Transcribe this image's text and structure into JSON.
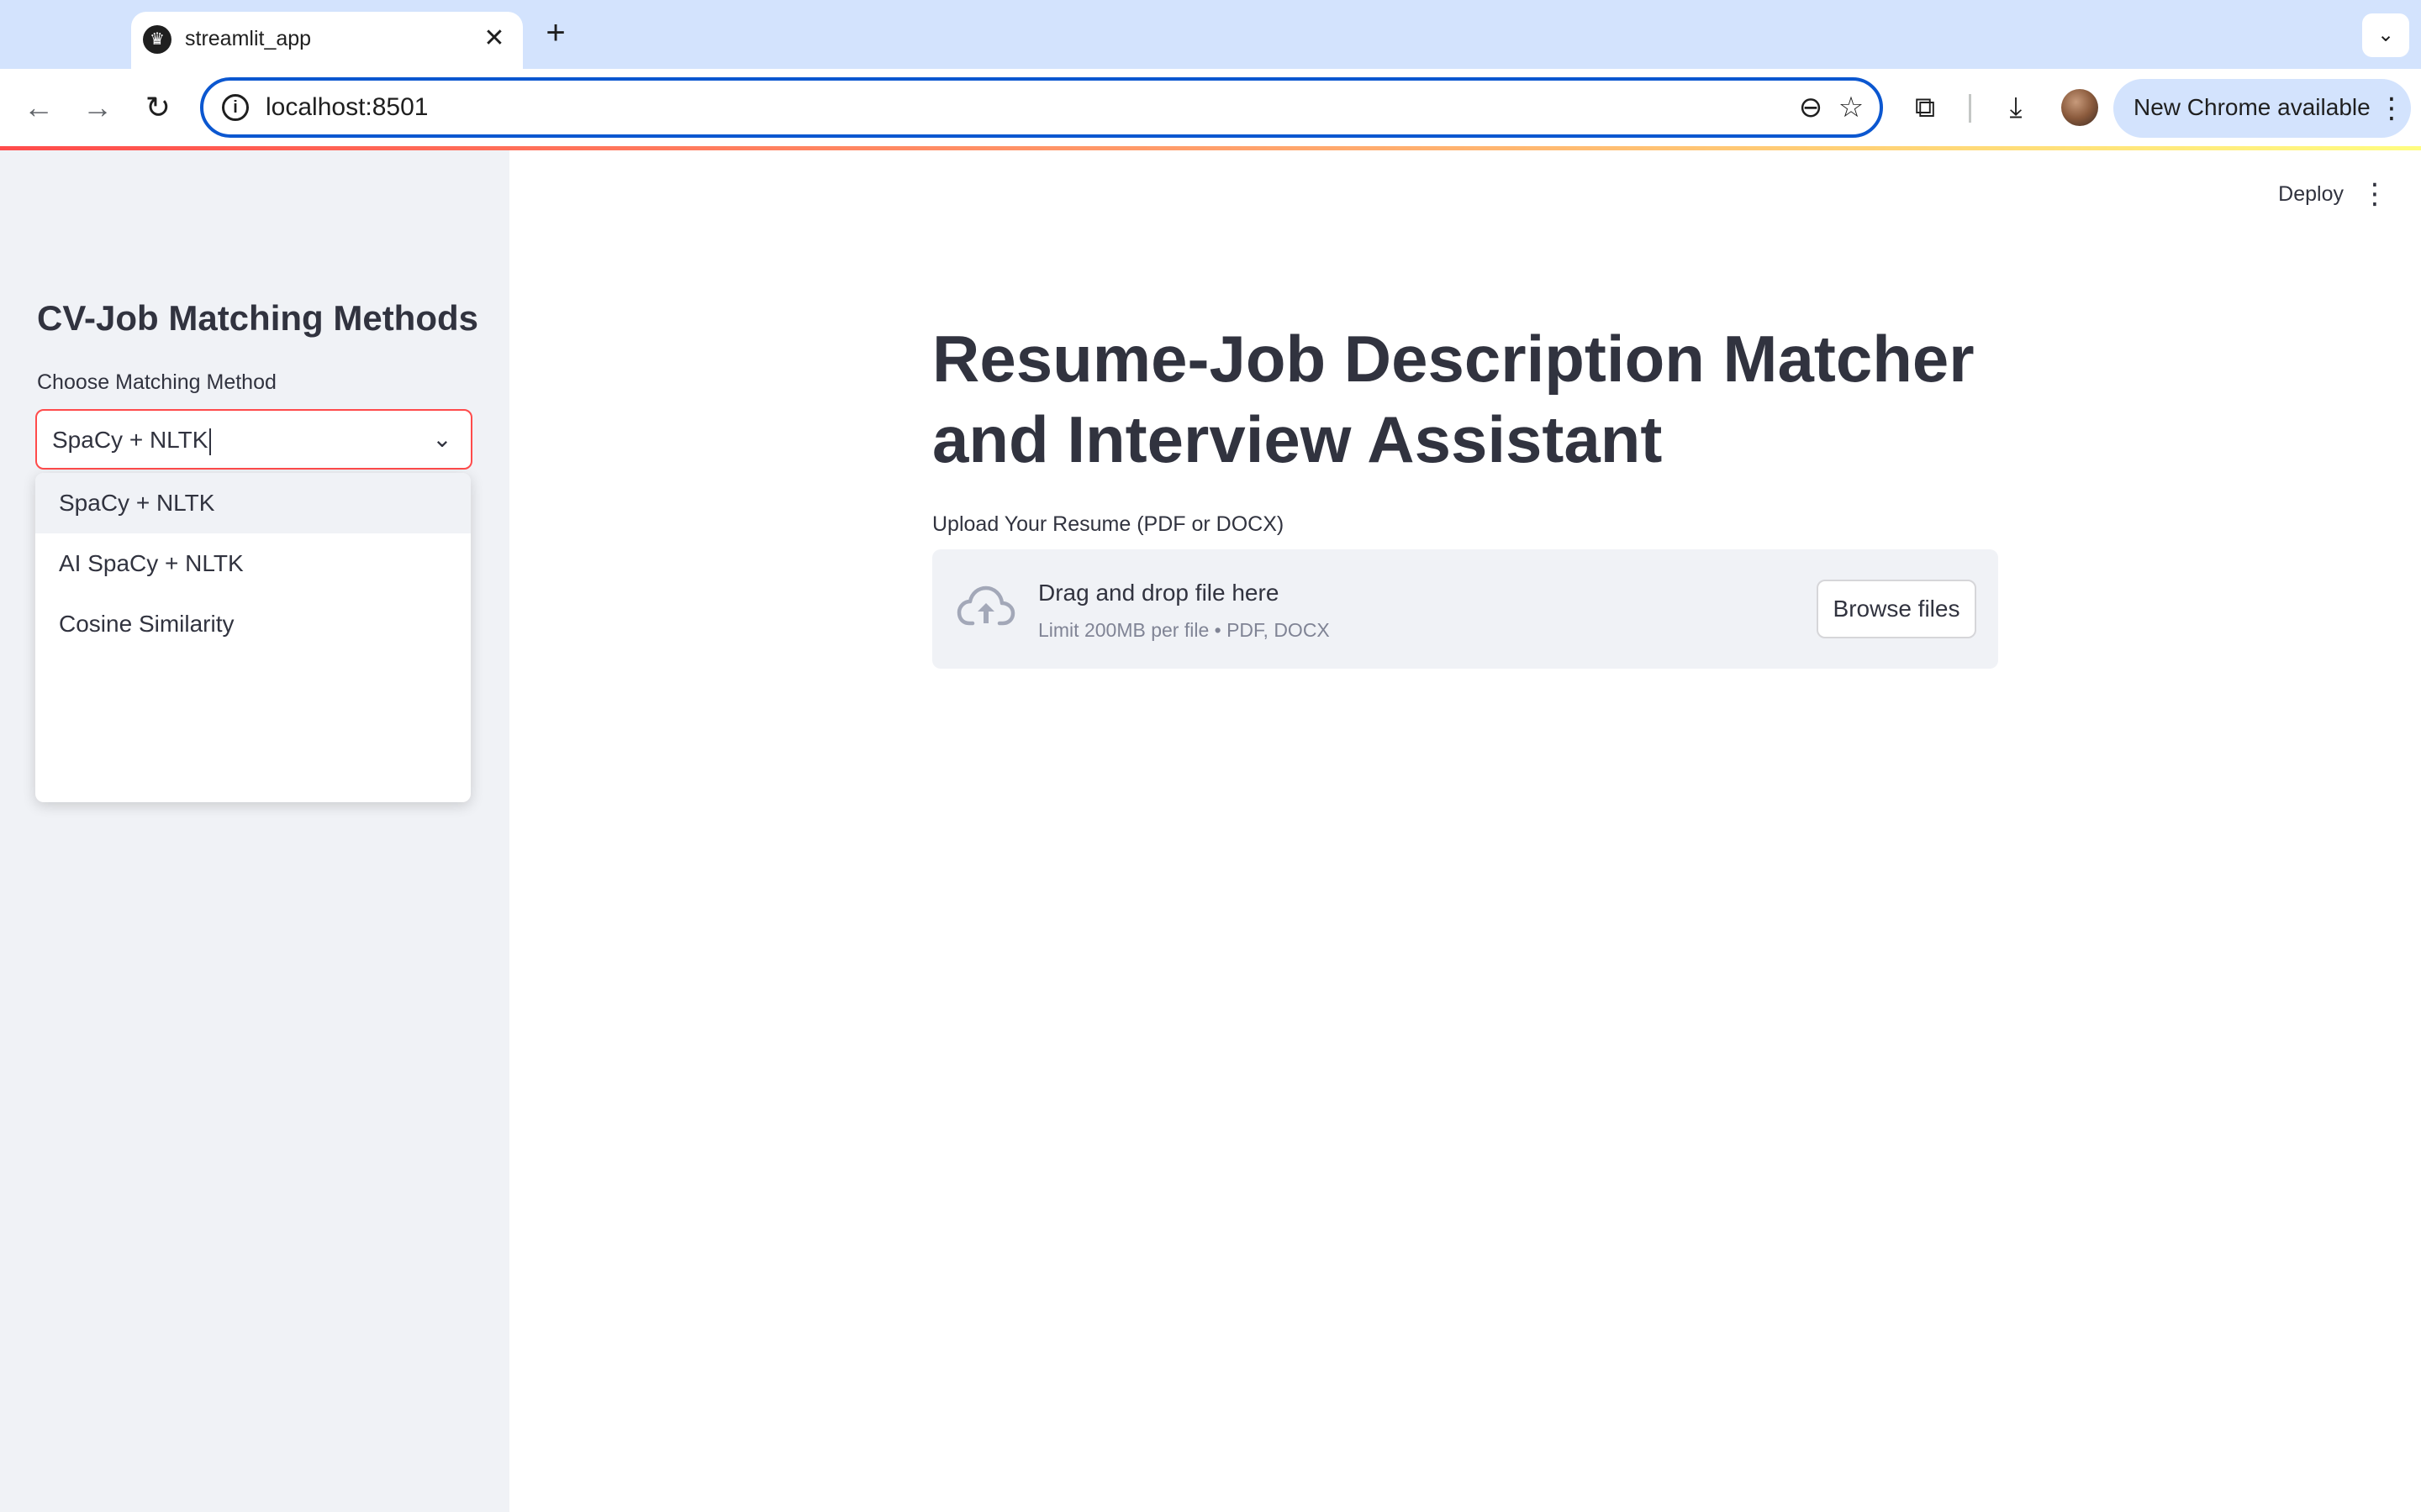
{
  "browser": {
    "tab_title": "streamlit_app",
    "url": "localhost:8501",
    "update_chip_label": "New Chrome available",
    "icons": {
      "tab_favicon": "streamlit-crown-icon",
      "tab_close": "close-icon",
      "new_tab": "plus-icon",
      "tab_search": "chevron-down-icon",
      "back": "arrow-left-icon",
      "forward": "arrow-right-icon",
      "reload": "reload-icon",
      "site_info": "info-icon",
      "zoom": "zoom-out-icon",
      "bookmark": "star-icon",
      "extensions": "puzzle-icon",
      "downloads": "download-icon",
      "menu": "kebab-menu-icon"
    },
    "glyphs": {
      "tab_favicon": "♛",
      "tab_close": "✕",
      "new_tab": "+",
      "tab_search": "⌄",
      "back": "←",
      "forward": "→",
      "reload": "↻",
      "site_info": "i",
      "zoom": "⊖",
      "bookmark": "☆",
      "extensions": "⧉",
      "downloads": "⤓",
      "menu": "⋮"
    }
  },
  "sidebar": {
    "title": "CV-Job Matching Methods",
    "select": {
      "label": "Choose Matching Method",
      "value": "SpaCy + NLTK",
      "chevron_glyph": "⌄",
      "options": [
        "SpaCy + NLTK",
        "AI SpaCy + NLTK",
        "Cosine Similarity"
      ]
    }
  },
  "main": {
    "header": {
      "deploy_label": "Deploy",
      "menu_glyph": "⋮"
    },
    "title": "Resume-Job Description Matcher and Interview Assistant",
    "uploader": {
      "label": "Upload Your Resume (PDF or DOCX)",
      "heading": "Drag and drop file here",
      "limit": "Limit 200MB per file • PDF, DOCX",
      "button_label": "Browse files",
      "icon": "cloud-upload-icon"
    }
  },
  "colors": {
    "accent": "#ff4b4b",
    "omnibox_focus": "#0b57d0",
    "tabstrip": "#d3e3fd",
    "sidebar_bg": "#f0f2f6",
    "text": "#31333f",
    "muted_text": "#808495"
  }
}
